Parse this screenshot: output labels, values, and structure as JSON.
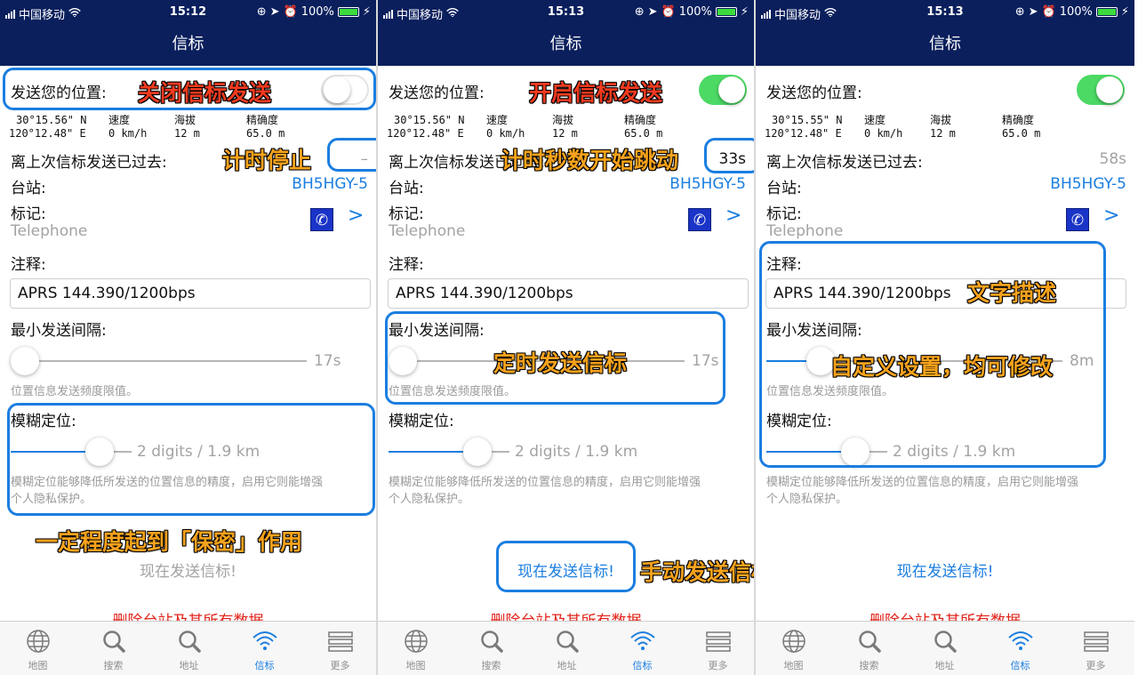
{
  "colors": {
    "navbar": "#0a1f5c",
    "accent": "#1b7ee0",
    "toggle_on": "#4cd964",
    "delete": "#e2231a",
    "annotation_red": "#f23a1f",
    "annotation_orange": "#f7a21c",
    "highlight": "#1b7ee0"
  },
  "status": {
    "carrier": "中国移动",
    "battery": "100%"
  },
  "nav_title": "信标",
  "labels": {
    "send_position": "发送您的位置:",
    "speed": "速度",
    "altitude": "海拔",
    "accuracy": "精确度",
    "since_last": "离上次信标发送已过去:",
    "station": "台站:",
    "symbol": "标记:",
    "comment": "注释:",
    "min_interval": "最小发送间隔:",
    "interval_hint": "位置信息发送频度限值。",
    "ambiguity": "模糊定位:",
    "ambiguity_hint_1": "模糊定位能够降低所发送的位置信息的精度，启用它则能增强",
    "ambiguity_hint_2": "个人隐私保护。",
    "send_now": "现在发送信标!",
    "delete": "删除台站及其所有数据"
  },
  "tabs": [
    {
      "label": "地图",
      "icon": "globe-icon"
    },
    {
      "label": "搜索",
      "icon": "search-icon"
    },
    {
      "label": "地址",
      "icon": "search-icon"
    },
    {
      "label": "信标",
      "icon": "wifi-icon",
      "active": true
    },
    {
      "label": "更多",
      "icon": "list-icon"
    }
  ],
  "screens": [
    {
      "time": "15:12",
      "toggle_on": false,
      "lat": "30°15.56\" N",
      "lon": "120°12.48\" E",
      "speed": "0 km/h",
      "altitude": "12 m",
      "accuracy": "65.0 m",
      "elapsed": "–",
      "station": "BH5HGY-5",
      "symbol_name": "Telephone",
      "comment": "APRS 144.390/1200bps",
      "interval_value": "17s",
      "interval_fraction": 0.0,
      "ambiguity_value": "2 digits / 1.9 km",
      "ambiguity_fraction": 0.5,
      "send_now_enabled": false,
      "annotations": {
        "a1": "关闭信标发送",
        "a2": "计时停止",
        "a3": "一定程度起到「保密」作用"
      }
    },
    {
      "time": "15:13",
      "toggle_on": true,
      "lat": "30°15.56\" N",
      "lon": "120°12.48\" E",
      "speed": "0 km/h",
      "altitude": "12 m",
      "accuracy": "65.0 m",
      "elapsed": "33s",
      "station": "BH5HGY-5",
      "symbol_name": "Telephone",
      "comment": "APRS 144.390/1200bps",
      "interval_value": "17s",
      "interval_fraction": 0.0,
      "ambiguity_value": "2 digits / 1.9 km",
      "ambiguity_fraction": 0.5,
      "send_now_enabled": true,
      "annotations": {
        "a1": "开启信标发送",
        "a2": "计时秒数开始跳动",
        "a3": "定时发送信标",
        "a4": "手动发送信标"
      }
    },
    {
      "time": "15:13",
      "toggle_on": true,
      "lat": "30°15.55\" N",
      "lon": "120°12.48\" E",
      "speed": "0 km/h",
      "altitude": "12 m",
      "accuracy": "65.0 m",
      "elapsed": "58s",
      "station": "BH5HGY-5",
      "symbol_name": "Telephone",
      "comment": "APRS 144.390/1200bps",
      "interval_value": "8m",
      "interval_fraction": 0.15,
      "ambiguity_value": "2 digits / 1.9 km",
      "ambiguity_fraction": 0.5,
      "send_now_enabled": true,
      "annotations": {
        "a1": "文字描述",
        "a2": "自定义设置，均可修改"
      }
    }
  ]
}
